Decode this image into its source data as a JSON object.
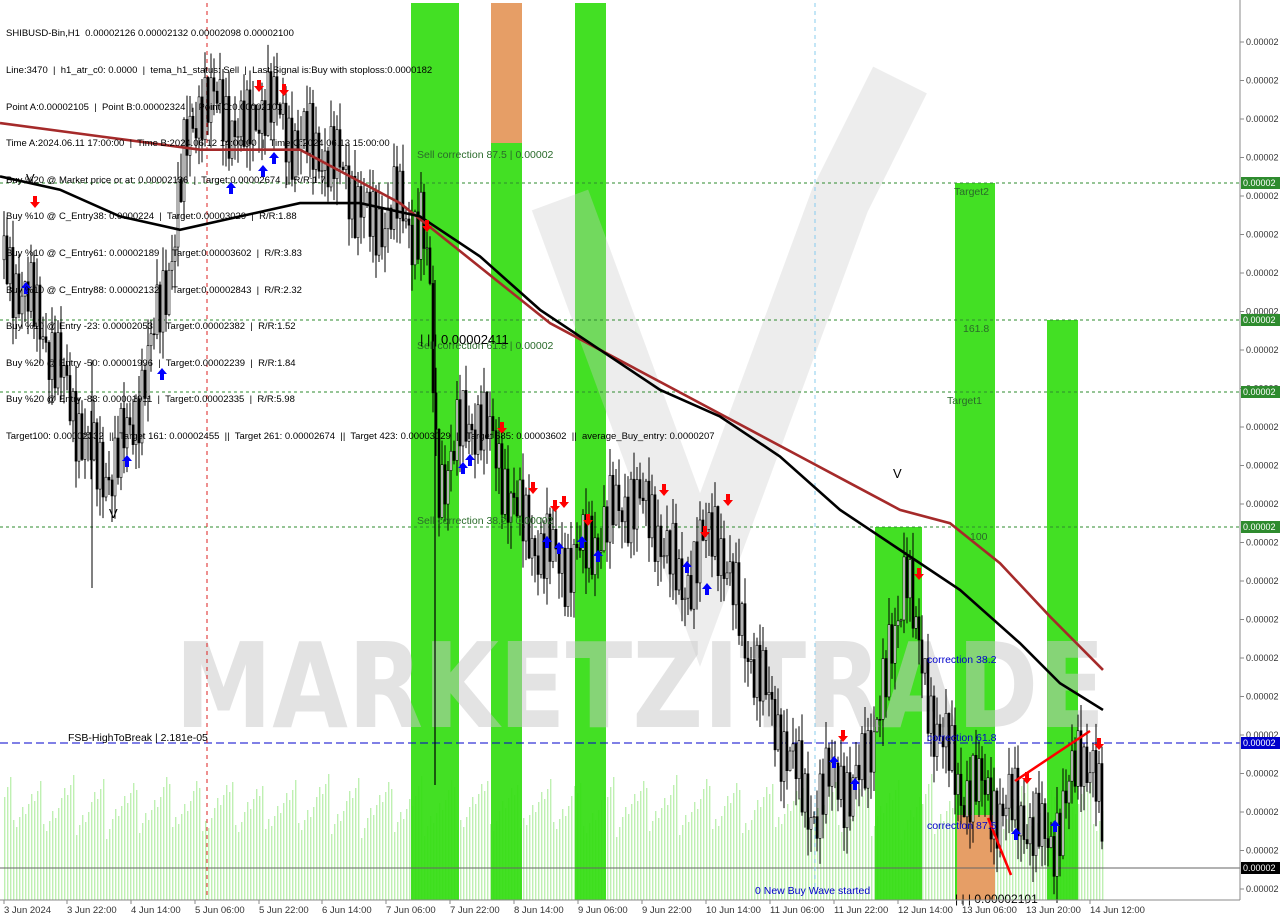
{
  "symbol_header": "SHIBUSD-Bin,H1  0.00002126 0.00002132 0.00002098 0.00002100",
  "info_lines": [
    "Line:3470  |  h1_atr_c0: 0.0000  |  tema_h1_status: Sell  |  Last Signal is:Buy with stoploss:0.0000182",
    "Point A:0.00002105  |  Point B:0.00002324  |  Point C:0.00002101",
    "Time A:2024.06.11 17:00:00  |  Time B:2024.06.12 14:00:00  |  Time C:2024.06.13 15:00:00",
    "Buy %20 @ Market price or at: 0.00002136  |  Target:0.00002674  |  R/R:1.7",
    "Buy %10 @ C_Entry38: 0.0000224  |  Target:0.00003029  |  R/R:1.88",
    "Buy %10 @ C_Entry61: 0.00002189  |  Target:0.00003602  |  R/R:3.83",
    "Buy %10 @ C_Entry88: 0.00002132  |  Target:0.00002843  |  R/R:2.32",
    "Buy %10 @ Entry -23: 0.00002053  |  Target:0.00002382  |  R/R:1.52",
    "Buy %20 @ Entry -50: 0.00001996  |  Target:0.00002239  |  R/R:1.84",
    "Buy %20 @ Entry -88: 0.00001911  |  Target:0.00002335  |  R/R:5.98"
  ],
  "targets_line": "Target100: 0.00002332  ||  Target 161: 0.00002455  ||  Target 261: 0.00002674  ||  Target 423: 0.00003029  ||  Target 685: 0.00003602  ||  average_Buy_entry: 0.0000207",
  "watermark": "MARKETZITRADE",
  "labels": {
    "sell_correction_875": "Sell correction 87.5 | 0.00002",
    "sell_correction_618": "Sell correction 61.8 | 0.00002",
    "sell_correction_382": "Sell correction 38.2 | 0.00002",
    "price_level": "| | | 0.00002411",
    "target2": "Target2",
    "fib_1618": "161.8",
    "target1": "Target1",
    "fib_100": "100",
    "correction_382": "correction 38.2",
    "correction_618": "correction 61.8",
    "correction_875": "correction 87.5",
    "fsb": "FSB-HighToBreak  |  2.181e-05",
    "new_buy_wave": "0 New Buy Wave started",
    "bottom_price": "| | | 0.00002101"
  },
  "price_axis_label": "0.00002",
  "x_axis": [
    "3 Jun 2024",
    "3 Jun 22:00",
    "4 Jun 14:00",
    "5 Jun 06:00",
    "5 Jun 22:00",
    "6 Jun 14:00",
    "7 Jun 06:00",
    "7 Jun 22:00",
    "8 Jun 14:00",
    "9 Jun 06:00",
    "9 Jun 22:00",
    "10 Jun 14:00",
    "11 Jun 06:00",
    "11 Jun 22:00",
    "12 Jun 14:00",
    "13 Jun 06:00",
    "13 Jun 20:00",
    "14 Jun 12:00"
  ],
  "colors": {
    "green_zone": "#33dd11",
    "orange_zone": "#ef9a6a",
    "ma_red": "#a52a2a",
    "ma_black": "#000000",
    "level_green": "#2e8b2e",
    "fsb_blue": "#0000cc",
    "candle": "#000000",
    "buy_arrow": "#0000ff",
    "sell_arrow": "#ff0000"
  },
  "chart_data": {
    "type": "candlestick",
    "symbol": "SHIBUSD-Bin",
    "timeframe": "H1",
    "ohlc_last": [
      2.126e-05,
      2.132e-05,
      2.098e-05,
      2.1e-05
    ],
    "point_a": 2.105e-05,
    "point_b": 2.324e-05,
    "point_c": 2.101e-05,
    "fsb_high_to_break": 2.181e-05,
    "key_levels": [
      2.411e-05,
      2.181e-05
    ],
    "price_path": [
      [
        0,
        2.54e-05
      ],
      [
        40,
        2.49e-05
      ],
      [
        70,
        2.43e-05
      ],
      [
        95,
        2.38e-05
      ],
      [
        110,
        2.38e-05
      ],
      [
        130,
        2.41e-05
      ],
      [
        150,
        2.47e-05
      ],
      [
        170,
        2.54e-05
      ],
      [
        185,
        2.62e-05
      ],
      [
        200,
        2.66e-05
      ],
      [
        220,
        2.65e-05
      ],
      [
        245,
        2.63e-05
      ],
      [
        265,
        2.66e-05
      ],
      [
        290,
        2.63e-05
      ],
      [
        320,
        2.62e-05
      ],
      [
        345,
        2.6e-05
      ],
      [
        370,
        2.56e-05
      ],
      [
        395,
        2.58e-05
      ],
      [
        410,
        2.56e-05
      ],
      [
        420,
        2.57e-05
      ],
      [
        428,
        2.52e-05
      ],
      [
        436,
        2.37e-05
      ],
      [
        445,
        2.38e-05
      ],
      [
        460,
        2.41e-05
      ],
      [
        480,
        2.42e-05
      ],
      [
        500,
        2.38e-05
      ],
      [
        520,
        2.34e-05
      ],
      [
        540,
        2.32e-05
      ],
      [
        565,
        2.31e-05
      ],
      [
        585,
        2.32e-05
      ],
      [
        605,
        2.34e-05
      ],
      [
        630,
        2.36e-05
      ],
      [
        655,
        2.34e-05
      ],
      [
        680,
        2.29e-05
      ],
      [
        700,
        2.32e-05
      ],
      [
        715,
        2.34e-05
      ],
      [
        730,
        2.29e-05
      ],
      [
        750,
        2.24e-05
      ],
      [
        770,
        2.2e-05
      ],
      [
        790,
        2.16e-05
      ],
      [
        815,
        2.12e-05
      ],
      [
        835,
        2.16e-05
      ],
      [
        850,
        2.13e-05
      ],
      [
        870,
        2.18e-05
      ],
      [
        885,
        2.22e-05
      ],
      [
        895,
        2.26e-05
      ],
      [
        905,
        2.32e-05
      ],
      [
        915,
        2.25e-05
      ],
      [
        930,
        2.2e-05
      ],
      [
        945,
        2.17e-05
      ],
      [
        960,
        2.14e-05
      ],
      [
        985,
        2.14e-05
      ],
      [
        1000,
        2.12e-05
      ],
      [
        1015,
        2.13e-05
      ],
      [
        1030,
        2.11e-05
      ],
      [
        1050,
        2.1e-05
      ],
      [
        1065,
        2.13e-05
      ],
      [
        1080,
        2.17e-05
      ],
      [
        1092,
        2.16e-05
      ],
      [
        1103,
        2.1e-05
      ]
    ],
    "ma_red": [
      [
        0,
        2.64e-05
      ],
      [
        100,
        2.63e-05
      ],
      [
        200,
        2.62e-05
      ],
      [
        300,
        2.62e-05
      ],
      [
        350,
        2.6e-05
      ],
      [
        400,
        2.58e-05
      ],
      [
        450,
        2.55e-05
      ],
      [
        500,
        2.52e-05
      ],
      [
        550,
        2.49e-05
      ],
      [
        600,
        2.47e-05
      ],
      [
        650,
        2.45e-05
      ],
      [
        700,
        2.43e-05
      ],
      [
        750,
        2.41e-05
      ],
      [
        800,
        2.39e-05
      ],
      [
        850,
        2.37e-05
      ],
      [
        900,
        2.35e-05
      ],
      [
        950,
        2.34e-05
      ],
      [
        1000,
        2.31e-05
      ],
      [
        1050,
        2.27e-05
      ],
      [
        1103,
        2.23e-05
      ]
    ],
    "ma_black": [
      [
        0,
        2.6e-05
      ],
      [
        60,
        2.59e-05
      ],
      [
        120,
        2.57e-05
      ],
      [
        180,
        2.56e-05
      ],
      [
        240,
        2.57e-05
      ],
      [
        300,
        2.58e-05
      ],
      [
        360,
        2.58e-05
      ],
      [
        420,
        2.57e-05
      ],
      [
        480,
        2.54e-05
      ],
      [
        540,
        2.5e-05
      ],
      [
        600,
        2.47e-05
      ],
      [
        660,
        2.44e-05
      ],
      [
        720,
        2.42e-05
      ],
      [
        780,
        2.39e-05
      ],
      [
        840,
        2.35e-05
      ],
      [
        900,
        2.32e-05
      ],
      [
        960,
        2.29e-05
      ],
      [
        1020,
        2.25e-05
      ],
      [
        1060,
        2.22e-05
      ],
      [
        1103,
        2.2e-05
      ]
    ],
    "y_range": [
      2.065e-05,
      2.73e-05
    ]
  }
}
